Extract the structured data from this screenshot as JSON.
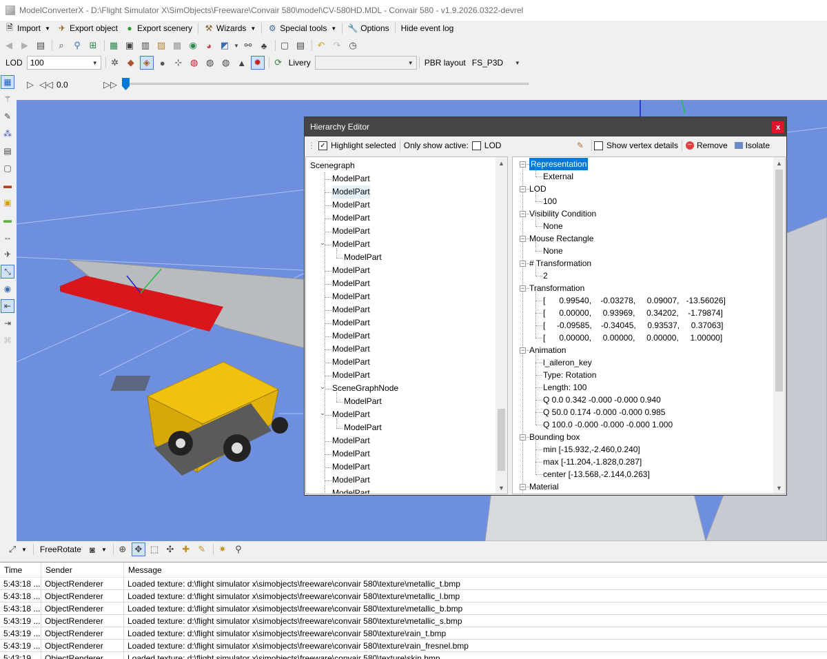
{
  "window": {
    "title": "ModelConverterX - D:\\Flight Simulator X\\SimObjects\\Freeware\\Convair 580\\model\\CV-580HD.MDL - Convair 580 - v1.9.2026.0322-devrel"
  },
  "menu": {
    "import": "Import",
    "export_object": "Export object",
    "export_scenery": "Export scenery",
    "wizards": "Wizards",
    "special_tools": "Special tools",
    "options": "Options",
    "hide_event_log": "Hide event log"
  },
  "toolbar3": {
    "lod_label": "LOD",
    "lod_value": "100",
    "livery_label": "Livery",
    "livery_value": "",
    "pbr_label": "PBR layout",
    "pbr_value": "FS_P3D"
  },
  "animation": {
    "time_value": "0.0"
  },
  "bottombar": {
    "camera_mode": "FreeRotate"
  },
  "hierarchy_editor": {
    "title": "Hierarchy Editor",
    "highlight_selected": "Highlight selected",
    "only_show_active": "Only show active:",
    "lod_label": "LOD",
    "show_vertex_details": "Show vertex details",
    "remove": "Remove",
    "isolate": "Isolate",
    "scenegraph": {
      "root": "Scenegraph",
      "nodes": [
        {
          "label": "ModelPart",
          "level": 1,
          "expand": ""
        },
        {
          "label": "ModelPart",
          "level": 1,
          "expand": "",
          "hover": true
        },
        {
          "label": "ModelPart",
          "level": 1,
          "expand": ""
        },
        {
          "label": "ModelPart",
          "level": 1,
          "expand": ""
        },
        {
          "label": "ModelPart",
          "level": 1,
          "expand": ""
        },
        {
          "label": "ModelPart",
          "level": 1,
          "expand": "open"
        },
        {
          "label": "ModelPart",
          "level": 2,
          "expand": ""
        },
        {
          "label": "ModelPart",
          "level": 1,
          "expand": ""
        },
        {
          "label": "ModelPart",
          "level": 1,
          "expand": ""
        },
        {
          "label": "ModelPart",
          "level": 1,
          "expand": ""
        },
        {
          "label": "ModelPart",
          "level": 1,
          "expand": ""
        },
        {
          "label": "ModelPart",
          "level": 1,
          "expand": ""
        },
        {
          "label": "ModelPart",
          "level": 1,
          "expand": ""
        },
        {
          "label": "ModelPart",
          "level": 1,
          "expand": ""
        },
        {
          "label": "ModelPart",
          "level": 1,
          "expand": ""
        },
        {
          "label": "ModelPart",
          "level": 1,
          "expand": ""
        },
        {
          "label": "SceneGraphNode",
          "level": 1,
          "expand": "open"
        },
        {
          "label": "ModelPart",
          "level": 2,
          "expand": ""
        },
        {
          "label": "ModelPart",
          "level": 1,
          "expand": "open"
        },
        {
          "label": "ModelPart",
          "level": 2,
          "expand": ""
        },
        {
          "label": "ModelPart",
          "level": 1,
          "expand": ""
        },
        {
          "label": "ModelPart",
          "level": 1,
          "expand": ""
        },
        {
          "label": "ModelPart",
          "level": 1,
          "expand": ""
        },
        {
          "label": "ModelPart",
          "level": 1,
          "expand": ""
        },
        {
          "label": "ModelPart",
          "level": 1,
          "expand": ""
        }
      ]
    },
    "properties": [
      {
        "label": "Representation",
        "level": 0,
        "expand": "minus",
        "selected": true
      },
      {
        "label": "External",
        "level": 1
      },
      {
        "label": "LOD",
        "level": 0,
        "expand": "minus"
      },
      {
        "label": "100",
        "level": 1
      },
      {
        "label": "Visibility Condition",
        "level": 0,
        "expand": "minus"
      },
      {
        "label": "None",
        "level": 1
      },
      {
        "label": "Mouse Rectangle",
        "level": 0,
        "expand": "minus"
      },
      {
        "label": "None",
        "level": 1
      },
      {
        "label": "# Transformation",
        "level": 0,
        "expand": "minus"
      },
      {
        "label": "2",
        "level": 1
      },
      {
        "label": "Transformation",
        "level": 0,
        "expand": "minus"
      },
      {
        "label": "[      0.99540,    -0.03278,     0.09007,   -13.56026]",
        "level": 1
      },
      {
        "label": "[      0.00000,     0.93969,     0.34202,    -1.79874]",
        "level": 1
      },
      {
        "label": "[     -0.09585,    -0.34045,     0.93537,     0.37063]",
        "level": 1
      },
      {
        "label": "[      0.00000,     0.00000,     0.00000,     1.00000]",
        "level": 1
      },
      {
        "label": "Animation",
        "level": 0,
        "expand": "minus"
      },
      {
        "label": "l_aileron_key",
        "level": 1
      },
      {
        "label": "Type: Rotation",
        "level": 1
      },
      {
        "label": "Length: 100",
        "level": 1
      },
      {
        "label": "Q 0.0 0.342 -0.000 -0.000 0.940",
        "level": 1
      },
      {
        "label": "Q 50.0 0.174 -0.000 -0.000 0.985",
        "level": 1
      },
      {
        "label": "Q 100.0 -0.000 -0.000 -0.000 1.000",
        "level": 1
      },
      {
        "label": "Bounding box",
        "level": 0,
        "expand": "minus"
      },
      {
        "label": "min [-15.932,-2.460,0.240]",
        "level": 1
      },
      {
        "label": "max [-11.204,-1.828,0.287]",
        "level": 1
      },
      {
        "label": "center [-13.568,-2.144,0.263]",
        "level": 1
      },
      {
        "label": "Material",
        "level": 0,
        "expand": "minus"
      }
    ]
  },
  "log": {
    "headers": [
      "Time",
      "Sender",
      "Message"
    ],
    "rows": [
      [
        "5:43:18 ...",
        "ObjectRenderer",
        "Loaded texture: d:\\flight simulator x\\simobjects\\freeware\\convair 580\\texture\\metallic_t.bmp"
      ],
      [
        "5:43:18 ...",
        "ObjectRenderer",
        "Loaded texture: d:\\flight simulator x\\simobjects\\freeware\\convair 580\\texture\\metallic_l.bmp"
      ],
      [
        "5:43:18 ...",
        "ObjectRenderer",
        "Loaded texture: d:\\flight simulator x\\simobjects\\freeware\\convair 580\\texture\\metallic_b.bmp"
      ],
      [
        "5:43:19 ...",
        "ObjectRenderer",
        "Loaded texture: d:\\flight simulator x\\simobjects\\freeware\\convair 580\\texture\\metallic_s.bmp"
      ],
      [
        "5:43:19 ...",
        "ObjectRenderer",
        "Loaded texture: d:\\flight simulator x\\simobjects\\freeware\\convair 580\\texture\\rain_t.bmp"
      ],
      [
        "5:43:19 ...",
        "ObjectRenderer",
        "Loaded texture: d:\\flight simulator x\\simobjects\\freeware\\convair 580\\texture\\rain_fresnel.bmp"
      ],
      [
        "5:43:19 ...",
        "ObjectRenderer",
        "Loaded texture: d:\\flight simulator x\\simobjects\\freeware\\convair 580\\texture\\skin.bmp"
      ]
    ]
  },
  "colors": {
    "viewport_sky": "#6e8fe0",
    "selection": "#0078d7",
    "dialog_title": "#454545",
    "close_button": "#e0142a"
  }
}
